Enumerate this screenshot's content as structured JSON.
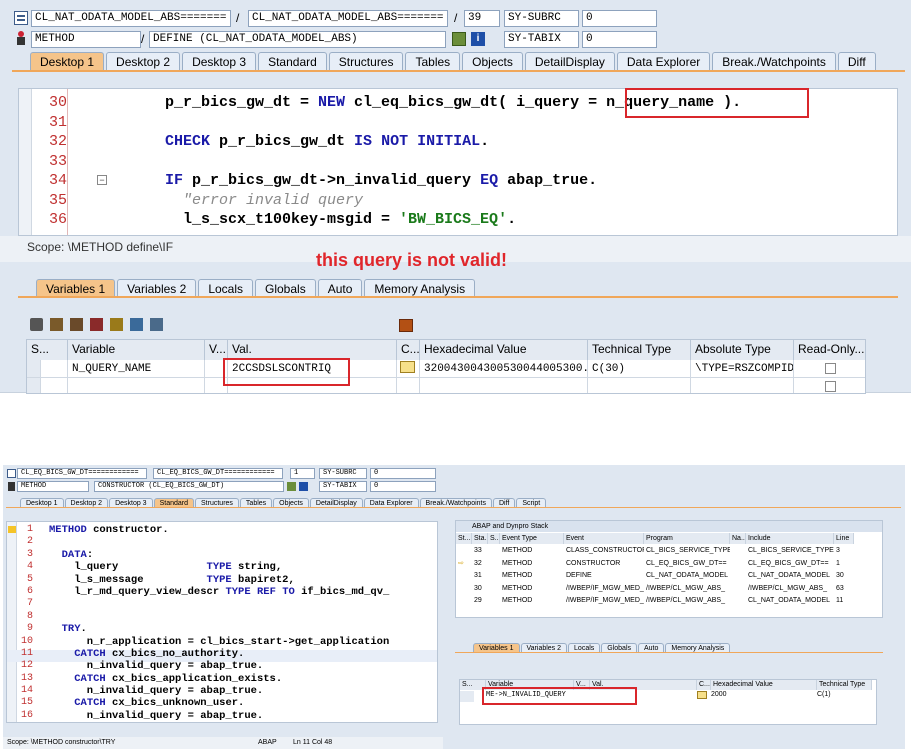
{
  "top": {
    "row1": {
      "field1": "CL_NAT_ODATA_MODEL_ABS=======",
      "sep1": "/",
      "field2": "CL_NAT_ODATA_MODEL_ABS=======",
      "sep2": "/",
      "line": "39",
      "sysvar": "SY-SUBRC",
      "value": "0"
    },
    "row2": {
      "field1": "METHOD",
      "sep1": "/",
      "field2": "DEFINE (CL_NAT_ODATA_MODEL_ABS)",
      "sysvar": "SY-TABIX",
      "value": "0"
    },
    "tabs": [
      "Desktop 1",
      "Desktop 2",
      "Desktop 3",
      "Standard",
      "Structures",
      "Tables",
      "Objects",
      "DetailDisplay",
      "Data Explorer",
      "Break./Watchpoints",
      "Diff"
    ],
    "code": [
      {
        "n": "30",
        "t": "p_r_bics_gw_dt = NEW cl_eq_bics_gw_dt( i_query = n_query_name )."
      },
      {
        "n": "31",
        "t": ""
      },
      {
        "n": "32",
        "t": "CHECK p_r_bics_gw_dt IS NOT INITIAL."
      },
      {
        "n": "33",
        "t": ""
      },
      {
        "n": "34",
        "t": "IF p_r_bics_gw_dt->n_invalid_query EQ abap_true."
      },
      {
        "n": "35",
        "t": "  \"error invalid query"
      },
      {
        "n": "36",
        "t": "  l_s_scx_t100key-msgid = 'BW_BICS_EQ'."
      }
    ],
    "scope": "Scope: \\METHOD define\\IF",
    "annotation": "this query is not valid!",
    "var_tabs": [
      "Variables 1",
      "Variables 2",
      "Locals",
      "Globals",
      "Auto",
      "Memory Analysis"
    ],
    "columns": [
      "S...",
      "Variable",
      "V...",
      "Val.",
      "C...",
      "Hexadecimal Value",
      "Technical Type",
      "Absolute Type",
      "Read-Only..."
    ],
    "row": {
      "variable": "N_QUERY_NAME",
      "value": "2CCSDSLSCONTRIQ",
      "hex": "320043004300530044005300...",
      "tech": "C(30)",
      "abs": "\\TYPE=RSZCOMPID"
    }
  },
  "bottom": {
    "row1": {
      "field1": "CL_EQ_BICS_GW_DT============",
      "field2": "CL_EQ_BICS_GW_DT============",
      "line": "1",
      "sysvar": "SY-SUBRC",
      "value": "0"
    },
    "row2": {
      "field1": "METHOD",
      "field2": "CONSTRUCTOR (CL_EQ_BICS_GW_DT)",
      "sysvar": "SY-TABIX",
      "value": "0"
    },
    "tabs": [
      "Desktop 1",
      "Desktop 2",
      "Desktop 3",
      "Standard",
      "Structures",
      "Tables",
      "Objects",
      "DetailDisplay",
      "Data Explorer",
      "Break./Watchpoints",
      "Diff",
      "Script"
    ],
    "code": [
      {
        "n": "1",
        "t": "METHOD constructor."
      },
      {
        "n": "2",
        "t": ""
      },
      {
        "n": "3",
        "t": "  DATA:"
      },
      {
        "n": "4",
        "t": "    l_query              TYPE string,"
      },
      {
        "n": "5",
        "t": "    l_s_message          TYPE bapiret2,"
      },
      {
        "n": "6",
        "t": "    l_r_md_query_view_descr TYPE REF TO if_bics_md_qv_"
      },
      {
        "n": "7",
        "t": ""
      },
      {
        "n": "8",
        "t": ""
      },
      {
        "n": "9",
        "t": "  TRY."
      },
      {
        "n": "10",
        "t": "      n_r_application = cl_bics_start->get_application"
      },
      {
        "n": "11",
        "t": "    CATCH cx_bics_no_authority."
      },
      {
        "n": "12",
        "t": "      n_invalid_query = abap_true."
      },
      {
        "n": "13",
        "t": "    CATCH cx_bics_application_exists."
      },
      {
        "n": "14",
        "t": "      n_invalid_query = abap_true."
      },
      {
        "n": "15",
        "t": "    CATCH cx_bics_unknown_user."
      },
      {
        "n": "16",
        "t": "      n_invalid_query = abap_true."
      }
    ],
    "status": {
      "scope": "Scope: \\METHOD constructor\\TRY",
      "lang": "ABAP",
      "pos": "Ln  11 Col  48"
    },
    "stack_title": "ABAP and Dynpro Stack",
    "stack_cols": [
      "St...",
      "Sta...",
      "S...",
      "Event Type",
      "Event",
      "Program",
      "Na...",
      "Include",
      "Line"
    ],
    "stack_rows": [
      {
        "sta": "33",
        "etype": "METHOD",
        "event": "CLASS_CONSTRUCTOR",
        "prog": "CL_BICS_SERVICE_TYPE",
        "incl": "CL_BICS_SERVICE_TYPE",
        "line": "3"
      },
      {
        "sta": "32",
        "etype": "METHOD",
        "event": "CONSTRUCTOR",
        "prog": "CL_EQ_BICS_GW_DT==",
        "incl": "CL_EQ_BICS_GW_DT==",
        "line": "1"
      },
      {
        "sta": "31",
        "etype": "METHOD",
        "event": "DEFINE",
        "prog": "CL_NAT_ODATA_MODEL",
        "incl": "CL_NAT_ODATA_MODEL",
        "line": "30"
      },
      {
        "sta": "30",
        "etype": "METHOD",
        "event": "/IWBEP/IF_MGW_MED_L",
        "prog": "/IWBEP/CL_MGW_ABS_",
        "incl": "/IWBEP/CL_MGW_ABS_",
        "line": "63"
      },
      {
        "sta": "29",
        "etype": "METHOD",
        "event": "/IWBEP/IF_MGW_MED_L",
        "prog": "/IWBEP/CL_MGW_ABS_",
        "incl": "CL_NAT_ODATA_MODEL",
        "line": "11"
      }
    ],
    "var_tabs": [
      "Variables 1",
      "Variables 2",
      "Locals",
      "Globals",
      "Auto",
      "Memory Analysis"
    ],
    "var_cols": [
      "S...",
      "Variable",
      "V...",
      "Val.",
      "C...",
      "Hexadecimal Value",
      "Technical Type"
    ],
    "var_row": {
      "variable": "ME->N_INVALID_QUERY",
      "hex": "2000",
      "tech": "C(1)"
    }
  }
}
